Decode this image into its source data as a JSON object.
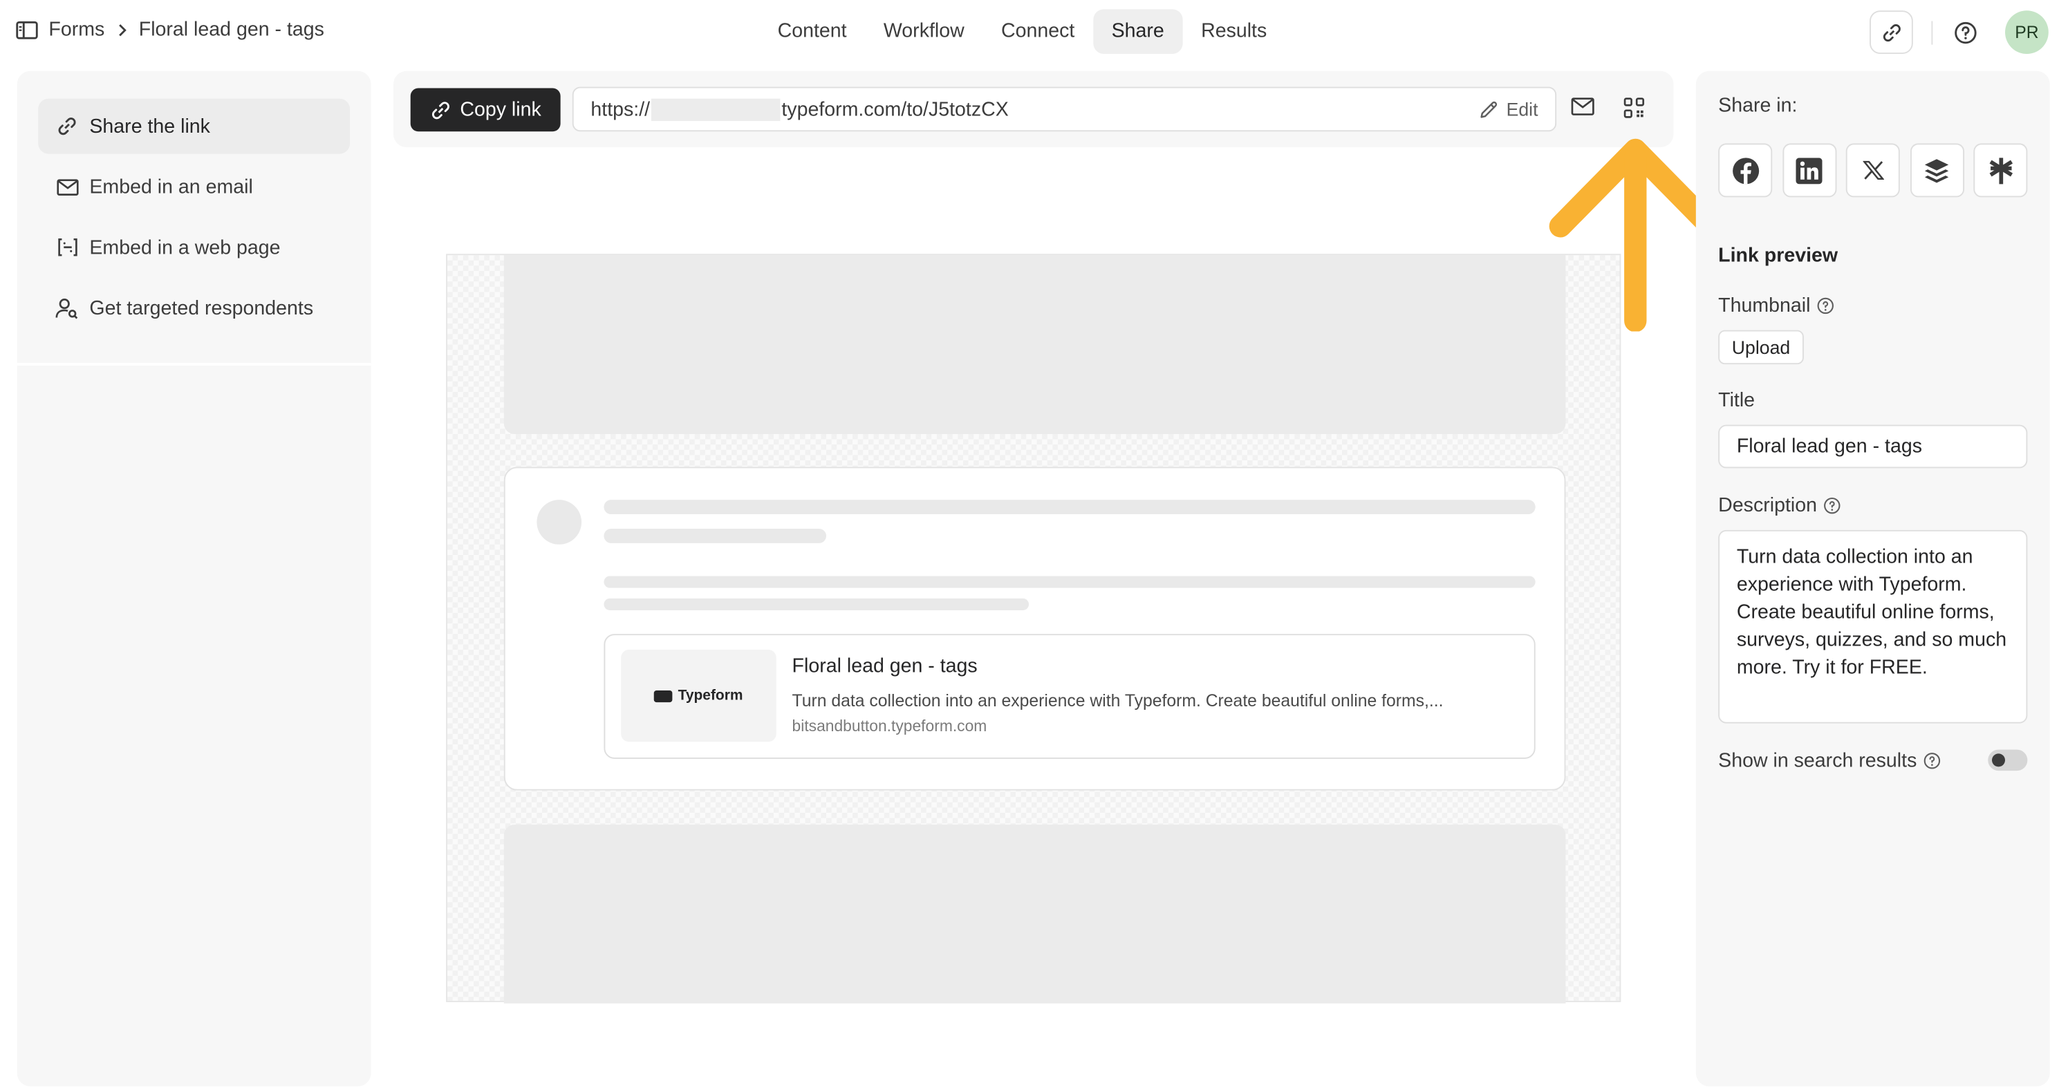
{
  "breadcrumb": {
    "root": "Forms",
    "current": "Floral lead gen - tags"
  },
  "tabs": [
    {
      "label": "Content"
    },
    {
      "label": "Workflow"
    },
    {
      "label": "Connect"
    },
    {
      "label": "Share",
      "active": true
    },
    {
      "label": "Results"
    }
  ],
  "user": {
    "initials": "PR",
    "avatar_color": "#c5e4c6"
  },
  "sidebar": {
    "items": [
      {
        "label": "Share the link",
        "icon": "link-icon",
        "active": true
      },
      {
        "label": "Embed in an email",
        "icon": "mail-icon"
      },
      {
        "label": "Embed in a web page",
        "icon": "code-brackets-icon"
      },
      {
        "label": "Get targeted respondents",
        "icon": "user-search-icon"
      }
    ]
  },
  "linkbar": {
    "copy_label": "Copy link",
    "url_prefix": "https://",
    "url_suffix": "typeform.com/to/J5totzCX",
    "edit_label": "Edit"
  },
  "preview": {
    "card_title": "Floral lead gen - tags",
    "card_description": "Turn data collection into an experience with Typeform. Create beautiful online forms,...",
    "card_domain": "bitsandbutton.typeform.com",
    "thumb_logo_text": "Typeform"
  },
  "right_panel": {
    "share_in_label": "Share in:",
    "socials": [
      "facebook-icon",
      "linkedin-icon",
      "x-icon",
      "buffer-icon",
      "asterisk-icon"
    ],
    "link_preview_label": "Link preview",
    "thumbnail_label": "Thumbnail",
    "upload_label": "Upload",
    "title_label": "Title",
    "title_value": "Floral lead gen - tags",
    "description_label": "Description",
    "description_value": "Turn data collection into an experience with Typeform. Create beautiful online forms, surveys, quizzes, and so much more. Try it for FREE.",
    "show_in_search_label": "Show in search results",
    "show_in_search_enabled": false
  },
  "colors": {
    "accent_dark": "#262627",
    "panel_bg": "#f7f7f7",
    "arrow": "#f9b233"
  }
}
